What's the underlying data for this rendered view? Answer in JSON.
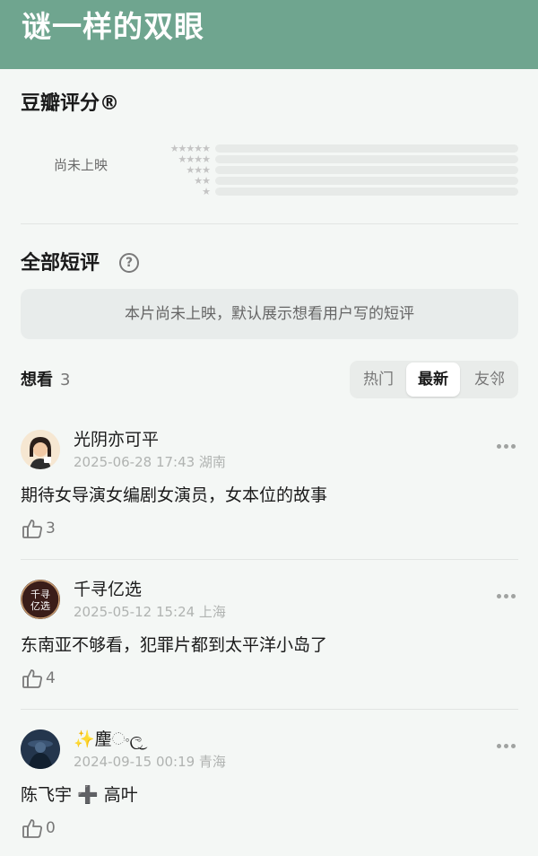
{
  "header": {
    "title": "谜一样的双眼"
  },
  "rating": {
    "title": "豆瓣评分®",
    "status": "尚未上映",
    "star_rows": [
      "★★★★★",
      "★★★★",
      "★★★",
      "★★",
      "★"
    ]
  },
  "reviews": {
    "section_title": "全部短评",
    "help_icon_glyph": "?",
    "notice": "本片尚未上映，默认展示想看用户写的短评",
    "want_label": "想看",
    "want_count": "3",
    "tabs": [
      "热门",
      "最新",
      "友邻"
    ],
    "active_tab": "最新"
  },
  "comments": [
    {
      "username": "光阴亦可平",
      "meta": "2025-06-28 17:43 湖南",
      "text": "期待女导演女编剧女演员，女本位的故事",
      "likes": "3",
      "avatar_icon": "cartoon-woman-avatar"
    },
    {
      "username": "千寻亿选",
      "meta": "2025-05-12 15:24 上海",
      "text": "东南亚不够看，犯罪片都到太平洋小岛了",
      "likes": "4",
      "avatar_icon": "text-logo-avatar",
      "avatar_text_1": "千寻",
      "avatar_text_2": "亿选"
    },
    {
      "username": "✨麈ංල͜",
      "meta": "2024-09-15 00:19 青海",
      "text": "陈飞宇 ➕ 高叶",
      "likes": "0",
      "avatar_icon": "dark-figure-avatar"
    }
  ],
  "colors": {
    "header_bg": "#6fa58f",
    "page_bg": "#f4f7f5",
    "muted_text": "#b0b3b1"
  }
}
